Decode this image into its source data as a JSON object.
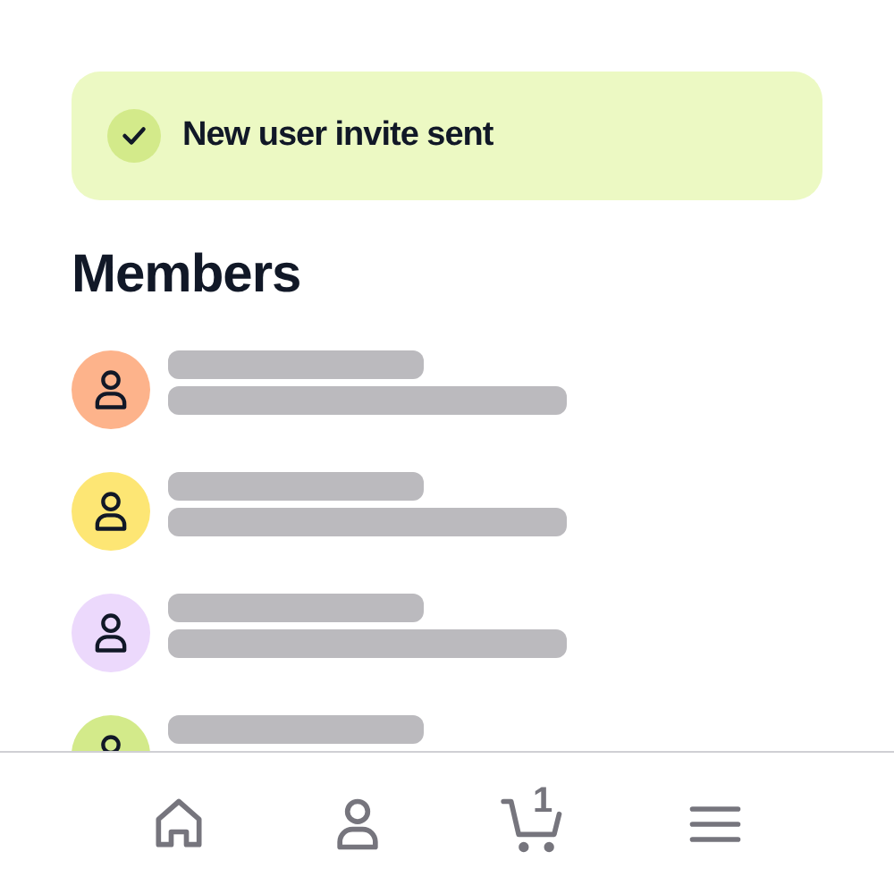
{
  "toast": {
    "message": "New user invite sent"
  },
  "section": {
    "title": "Members"
  },
  "members": [
    {
      "color": "#fdb38b"
    },
    {
      "color": "#fde674"
    },
    {
      "color": "#ecd9fc"
    },
    {
      "color": "#d3ea8a",
      "cut_off": true
    }
  ],
  "nav": [
    {
      "kind": "home"
    },
    {
      "kind": "profile"
    },
    {
      "kind": "cart",
      "count": "1"
    },
    {
      "kind": "menu"
    }
  ]
}
